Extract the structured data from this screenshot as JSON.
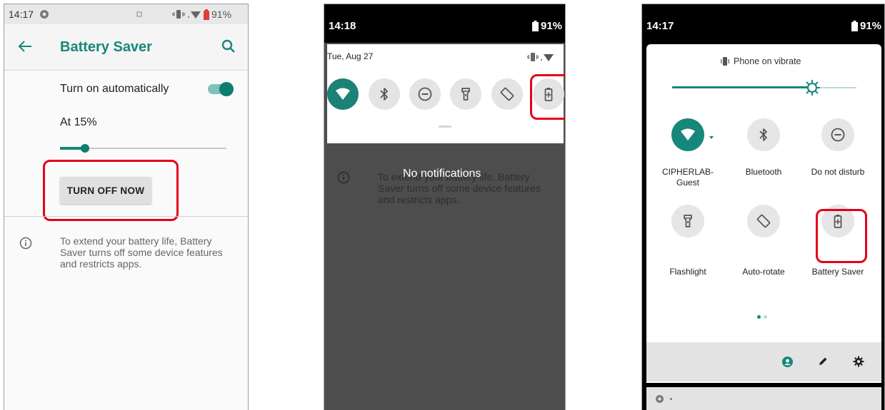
{
  "screen1": {
    "status": {
      "time": "14:17",
      "battery": "91%"
    },
    "appbar": {
      "title": "Battery Saver"
    },
    "auto": {
      "label": "Turn on automatically",
      "enabled": true
    },
    "threshold": {
      "label": "At 15%",
      "slider_value": 0.15
    },
    "button": {
      "label": "TURN OFF NOW"
    },
    "info": {
      "text_lines": [
        "To extend your battery life, Battery",
        "Saver turns off some device features",
        "and restricts apps."
      ]
    }
  },
  "screen2": {
    "status": {
      "time": "14:18",
      "battery": "91%"
    },
    "date": "Tue, Aug 27",
    "notification": {
      "message": "No notifications"
    },
    "behind_info": {
      "text_lines": [
        "To extend your battery life, Battery",
        "Saver turns off some device features",
        "and restricts apps."
      ]
    },
    "tiles": [
      {
        "icon": "wifi-icon",
        "active": true
      },
      {
        "icon": "bluetooth-icon",
        "active": false
      },
      {
        "icon": "do-not-disturb-icon",
        "active": false
      },
      {
        "icon": "flashlight-icon",
        "active": false
      },
      {
        "icon": "auto-rotate-icon",
        "active": false
      },
      {
        "icon": "battery-saver-icon",
        "active": false
      }
    ]
  },
  "screen3": {
    "status": {
      "time": "14:17",
      "battery": "91%"
    },
    "vibrate": {
      "label": "Phone on vibrate"
    },
    "brightness": {
      "value": 0.76
    },
    "tiles": [
      {
        "icon": "wifi-icon",
        "label_lines": [
          "CIPHERLAB-",
          "Guest"
        ],
        "active": true
      },
      {
        "icon": "bluetooth-icon",
        "label_lines": [
          "Bluetooth"
        ],
        "active": false
      },
      {
        "icon": "do-not-disturb-icon",
        "label_lines": [
          "Do not disturb"
        ],
        "active": false
      },
      {
        "icon": "flashlight-icon",
        "label_lines": [
          "Flashlight"
        ],
        "active": false
      },
      {
        "icon": "auto-rotate-icon",
        "label_lines": [
          "Auto-rotate"
        ],
        "active": false
      },
      {
        "icon": "battery-saver-icon",
        "label_lines": [
          "Battery Saver"
        ],
        "active": false
      }
    ],
    "page_dots": {
      "count": 2,
      "current": 1
    }
  },
  "colors": {
    "accent": "#17877a",
    "highlight": "#e3001b"
  }
}
